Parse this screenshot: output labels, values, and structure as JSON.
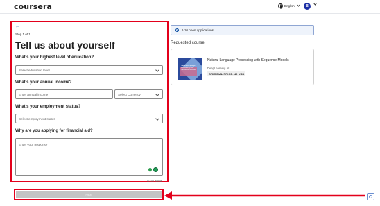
{
  "header": {
    "logo": "coursera",
    "language": "English",
    "avatar_initial": "B"
  },
  "form": {
    "back_arrow": "←",
    "step": "Step 1 of 1",
    "title": "Tell us about yourself",
    "education": {
      "question": "What's your highest level of education?",
      "placeholder": "Select education level"
    },
    "income": {
      "question": "What's your annual income?",
      "placeholder": "Enter annual income",
      "currency_placeholder": "Select Currency"
    },
    "employment": {
      "question": "What's your employment status?",
      "placeholder": "Select employment status"
    },
    "reason": {
      "question": "Why are you applying for financial aid?",
      "placeholder": "Enter your response",
      "counter": "0/150 words"
    },
    "next_label": "Next"
  },
  "sidebar": {
    "info_banner": "1/10 open applications.",
    "requested_label": "Requested course",
    "course": {
      "thumb_text": "Natural Language Processing with Sequence Models",
      "title": "Natural Language Processing with Sequence Models",
      "org": "DeepLearning.AI",
      "price": "ORIGINAL PRICE: 49 USD"
    }
  },
  "colors": {
    "highlight": "#e3001b",
    "brand_blue": "#0b4ea2",
    "avatar": "#1c2fa5",
    "next_disabled": "#c4c4c4"
  }
}
